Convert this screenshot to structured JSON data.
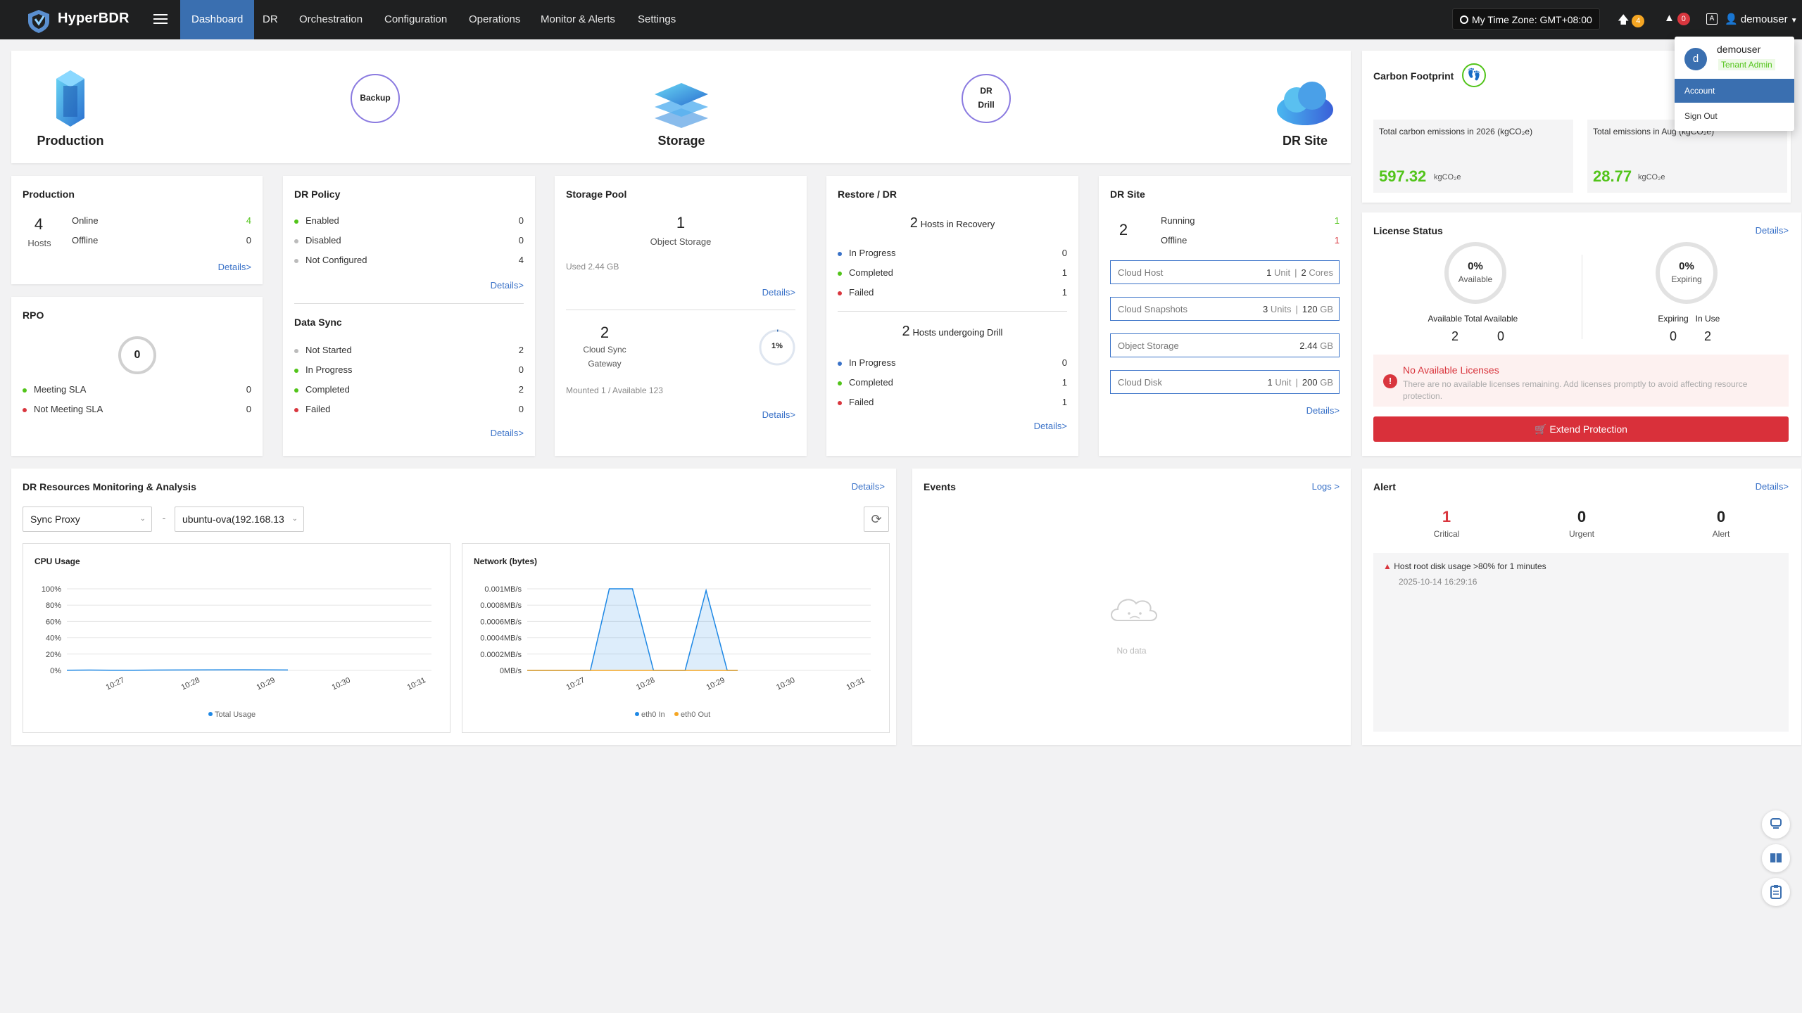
{
  "app": {
    "name": "HyperBDR"
  },
  "nav": [
    "Dashboard",
    "DR",
    "Orchestration",
    "Configuration",
    "Operations",
    "Monitor & Alerts",
    "Settings"
  ],
  "topbar": {
    "timezone": "My Time Zone: GMT+08:00",
    "upload_count": "4",
    "alert_count": "0",
    "username": "demouser"
  },
  "user_menu": {
    "avatar_letter": "d",
    "name": "demouser",
    "role": "Tenant Admin",
    "items": [
      "Account",
      "Sign Out"
    ]
  },
  "flow": {
    "production": "Production",
    "backup": "Backup",
    "storage": "Storage",
    "drill_1": "DR",
    "drill_2": "Drill",
    "dr_site": "DR Site"
  },
  "carbon": {
    "title": "Carbon Footprint",
    "total_label": "Total carbon emissions in 2026 (kgCO₂e)",
    "total_value": "597.32",
    "total_unit": "kgCO₂e",
    "month_label": "Total emissions in Aug (kgCO₂e)",
    "month_value": "28.77",
    "month_unit": "kgCO₂e"
  },
  "production": {
    "title": "Production",
    "hosts": "4",
    "hosts_label": "Hosts",
    "online_label": "Online",
    "online": "4",
    "offline_label": "Offline",
    "offline": "0",
    "details": "Details>"
  },
  "rpo": {
    "title": "RPO",
    "value": "0",
    "meeting_label": "Meeting SLA",
    "meeting": "0",
    "not_meeting_label": "Not Meeting SLA",
    "not_meeting": "0"
  },
  "dr_policy": {
    "title": "DR Policy",
    "rows": [
      {
        "label": "Enabled",
        "value": "0",
        "color": "#52c41a"
      },
      {
        "label": "Disabled",
        "value": "0",
        "color": "#bbbbbb"
      },
      {
        "label": "Not Configured",
        "value": "4",
        "color": "#bbbbbb"
      }
    ],
    "details": "Details>"
  },
  "data_sync": {
    "title": "Data Sync",
    "rows": [
      {
        "label": "Not Started",
        "value": "2",
        "color": "#bbbbbb"
      },
      {
        "label": "In Progress",
        "value": "0",
        "color": "#52c41a"
      },
      {
        "label": "Completed",
        "value": "2",
        "color": "#52c41a"
      },
      {
        "label": "Failed",
        "value": "0",
        "color": "#d9363e"
      }
    ],
    "details": "Details>"
  },
  "storage_pool": {
    "title": "Storage Pool",
    "object_count": "1",
    "object_label": "Object Storage",
    "used": "Used 2.44 GB",
    "details": "Details>",
    "gateway_count": "2",
    "gateway_label_1": "Cloud Sync",
    "gateway_label_2": "Gateway",
    "gateway_percent": "1%",
    "gateway_percent_value": 1,
    "mounted": "Mounted 1 / Available 123",
    "details2": "Details>"
  },
  "restore": {
    "title": "Restore / DR",
    "recovery_count": "2",
    "recovery_label": "Hosts in Recovery",
    "recovery_rows": [
      {
        "label": "In Progress",
        "value": "0",
        "color": "#3a72c8"
      },
      {
        "label": "Completed",
        "value": "1",
        "color": "#52c41a"
      },
      {
        "label": "Failed",
        "value": "1",
        "color": "#d9363e"
      }
    ],
    "drill_count": "2",
    "drill_label": "Hosts undergoing Drill",
    "drill_rows": [
      {
        "label": "In Progress",
        "value": "0",
        "color": "#3a72c8"
      },
      {
        "label": "Completed",
        "value": "1",
        "color": "#52c41a"
      },
      {
        "label": "Failed",
        "value": "1",
        "color": "#d9363e"
      }
    ],
    "details": "Details>"
  },
  "dr_site": {
    "title": "DR Site",
    "count": "2",
    "running_label": "Running",
    "running": "1",
    "offline_label": "Offline",
    "offline": "1",
    "boxes": [
      {
        "label": "Cloud Host",
        "v1": "1",
        "u1": "Unit",
        "v2": "2",
        "u2": "Cores"
      },
      {
        "label": "Cloud Snapshots",
        "v1": "3",
        "u1": "Units",
        "v2": "120",
        "u2": "GB"
      },
      {
        "label": "Object Storage",
        "v1": "",
        "u1": "",
        "v2": "2.44",
        "u2": "GB"
      },
      {
        "label": "Cloud Disk",
        "v1": "1",
        "u1": "Unit",
        "v2": "200",
        "u2": "GB"
      }
    ],
    "details": "Details>"
  },
  "license": {
    "title": "License Status",
    "details": "Details>",
    "available_pct": "0%",
    "available_label": "Available",
    "expiring_pct": "0%",
    "expiring_label": "Expiring",
    "available_total_label": "Available Total",
    "available_total": "2",
    "available_sub_label": "Available",
    "available_value": "0",
    "expiring_sub_label": "Expiring",
    "expiring_value": "0",
    "in_use_label": "In Use",
    "in_use_value": "2",
    "warning_title": "No Available Licenses",
    "warning_text": "There are no available licenses remaining. Add licenses promptly to avoid affecting resource protection.",
    "button": "Extend Protection"
  },
  "monitoring": {
    "title": "DR Resources Monitoring & Analysis",
    "details": "Details>",
    "select1": "Sync Proxy",
    "dash": "-",
    "select2": "ubuntu-ova(192.168.13"
  },
  "chart_data": [
    {
      "type": "line",
      "title": "CPU Usage",
      "x": [
        "10:27",
        "10:28",
        "10:29",
        "10:30",
        "10:31"
      ],
      "y_ticks": [
        "100%",
        "80%",
        "60%",
        "40%",
        "20%",
        "0%"
      ],
      "ylim": [
        0,
        100
      ],
      "series": [
        {
          "name": "Total Usage",
          "color": "#1e88e5",
          "points": [
            [
              0,
              0.3
            ],
            [
              0.2,
              0.4
            ],
            [
              0.4,
              0.2
            ],
            [
              0.6,
              0.3
            ],
            [
              0.8,
              0.4
            ],
            [
              1.0,
              0.5
            ],
            [
              1.3,
              0.6
            ],
            [
              1.6,
              0.8
            ],
            [
              2.0,
              0.5
            ]
          ]
        }
      ]
    },
    {
      "type": "area",
      "title": "Network (bytes)",
      "x": [
        "10:27",
        "10:28",
        "10:29",
        "10:30",
        "10:31"
      ],
      "y_ticks": [
        "0.001MB/s",
        "0.0008MB/s",
        "0.0006MB/s",
        "0.0004MB/s",
        "0.0002MB/s",
        "0MB/s"
      ],
      "ylim": [
        0,
        0.001
      ],
      "series": [
        {
          "name": "eth0 In",
          "color": "#1e88e5",
          "points": [
            [
              0,
              0
            ],
            [
              0.6,
              0
            ],
            [
              0.78,
              0.001
            ],
            [
              1.0,
              0.001
            ],
            [
              1.2,
              0
            ],
            [
              1.5,
              0
            ],
            [
              1.7,
              0.00098
            ],
            [
              1.9,
              0
            ],
            [
              2.0,
              0
            ]
          ]
        },
        {
          "name": "eth0 Out",
          "color": "#f5a623",
          "points": [
            [
              0,
              0
            ],
            [
              2.0,
              0
            ]
          ]
        }
      ]
    }
  ],
  "events": {
    "title": "Events",
    "logs": "Logs >",
    "empty": "No data"
  },
  "alert": {
    "title": "Alert",
    "details": "Details>",
    "critical": "1",
    "critical_label": "Critical",
    "urgent": "0",
    "urgent_label": "Urgent",
    "alert": "0",
    "alert_label": "Alert",
    "item_text": "Host root disk usage >80% for 1 minutes",
    "item_time": "2025-10-14 16:29:16"
  },
  "colors": {
    "brand": "#3a6fb0",
    "nav_bg": "#1f2021",
    "success": "#52c41a",
    "danger": "#d9363e",
    "link": "#3a72c8"
  }
}
